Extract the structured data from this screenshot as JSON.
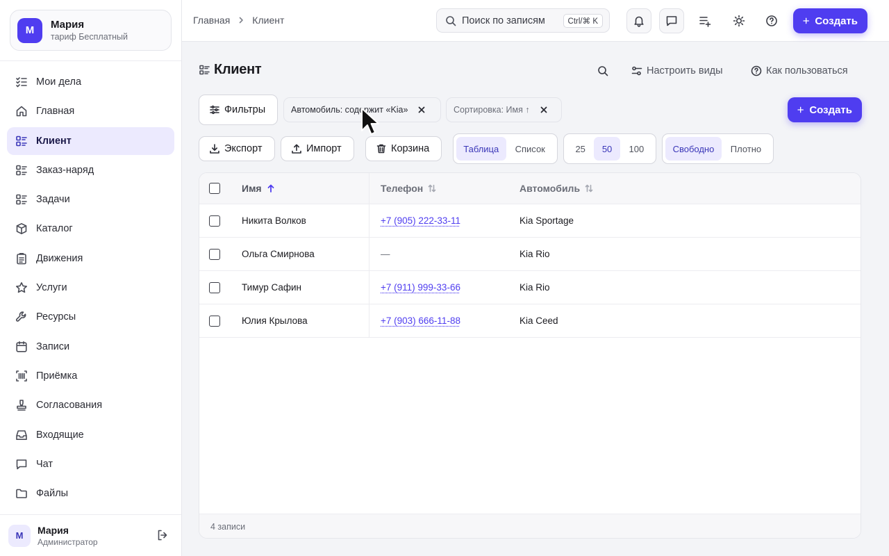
{
  "org": {
    "avatar": "М",
    "name": "Мария",
    "plan": "тариф Бесплатный"
  },
  "nav": [
    {
      "label": "Мои дела",
      "icon": "checklist-icon"
    },
    {
      "label": "Главная",
      "icon": "home-icon"
    },
    {
      "label": "Клиент",
      "icon": "list-icon",
      "active": true
    },
    {
      "label": "Заказ-наряд",
      "icon": "list-icon"
    },
    {
      "label": "Задачи",
      "icon": "list-icon"
    },
    {
      "label": "Каталог",
      "icon": "box-icon"
    },
    {
      "label": "Движения",
      "icon": "clipboard-icon"
    },
    {
      "label": "Услуги",
      "icon": "star-icon"
    },
    {
      "label": "Ресурсы",
      "icon": "wrench-icon"
    },
    {
      "label": "Записи",
      "icon": "calendar-icon"
    },
    {
      "label": "Приёмка",
      "icon": "barcode-icon"
    },
    {
      "label": "Согласования",
      "icon": "stamp-icon"
    },
    {
      "label": "Входящие",
      "icon": "inbox-icon"
    },
    {
      "label": "Чат",
      "icon": "chat-icon"
    },
    {
      "label": "Файлы",
      "icon": "folder-icon"
    }
  ],
  "user": {
    "avatar": "М",
    "name": "Мария",
    "role": "Администратор"
  },
  "breadcrumb": {
    "home": "Главная",
    "current": "Клиент"
  },
  "search": {
    "placeholder": "Поиск по записям",
    "shortcut": "Ctrl/⌘ K"
  },
  "topbar": {
    "create_label": "Создать"
  },
  "page": {
    "title": "Клиент",
    "configure_views": "Настроить виды",
    "how_to_use": "Как пользоваться"
  },
  "filters": {
    "button": "Фильтры",
    "chip_filter": "Автомобиль: содержит «Kia»",
    "chip_sort": "Сортировка: Имя ↑",
    "create_label": "Создать"
  },
  "toolbar": {
    "export": "Экспорт",
    "import": "Импорт",
    "trash": "Корзина",
    "view_modes": [
      "Таблица",
      "Список"
    ],
    "view_selected": "Таблица",
    "page_sizes": [
      "25",
      "50",
      "100"
    ],
    "page_size_selected": "50",
    "density": [
      "Свободно",
      "Плотно"
    ],
    "density_selected": "Свободно"
  },
  "table": {
    "columns": [
      "Имя",
      "Телефон",
      "Автомобиль"
    ],
    "rows": [
      {
        "name": "Никита Волков",
        "phone": "+7 (905) 222-33-11",
        "car": "Kia Sportage"
      },
      {
        "name": "Ольга Смирнова",
        "phone": "—",
        "car": "Kia Rio"
      },
      {
        "name": "Тимур Сафин",
        "phone": "+7 (911) 999-33-66",
        "car": "Kia Rio"
      },
      {
        "name": "Юлия Крылова",
        "phone": "+7 (903) 666-11-88",
        "car": "Kia Ceed"
      }
    ],
    "footer": "4 записи"
  },
  "colors": {
    "accent": "#4f3df0",
    "active_bg": "#eceafe"
  }
}
